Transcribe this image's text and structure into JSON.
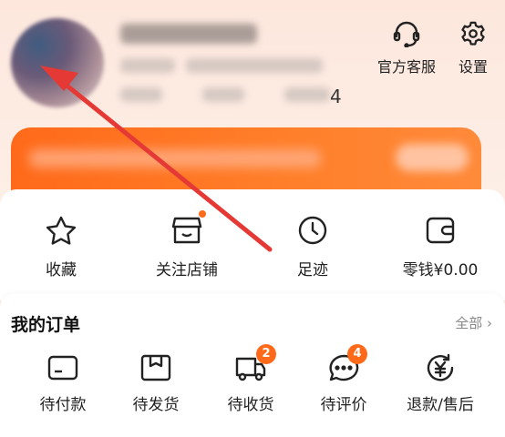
{
  "header": {
    "username": "",
    "actions": [
      {
        "label": "官方客服",
        "icon": "headset-icon"
      },
      {
        "label": "设置",
        "icon": "gear-icon"
      }
    ],
    "trailing_digit": "4"
  },
  "quick_links": [
    {
      "label": "收藏",
      "icon": "star-icon"
    },
    {
      "label": "关注店铺",
      "icon": "store-icon",
      "dot": true
    },
    {
      "label": "足迹",
      "icon": "clock-icon"
    },
    {
      "label": "零钱¥0.00",
      "icon": "wallet-icon"
    }
  ],
  "orders": {
    "title": "我的订单",
    "view_all": "全部",
    "items": [
      {
        "label": "待付款",
        "icon": "card-icon"
      },
      {
        "label": "待发货",
        "icon": "box-icon"
      },
      {
        "label": "待收货",
        "icon": "truck-icon",
        "badge": "2"
      },
      {
        "label": "待评价",
        "icon": "chat-icon",
        "badge": "4"
      },
      {
        "label": "退款/售后",
        "icon": "refund-icon"
      }
    ]
  },
  "colors": {
    "accent": "#ff6a1a",
    "annotation_arrow": "#e53935"
  }
}
